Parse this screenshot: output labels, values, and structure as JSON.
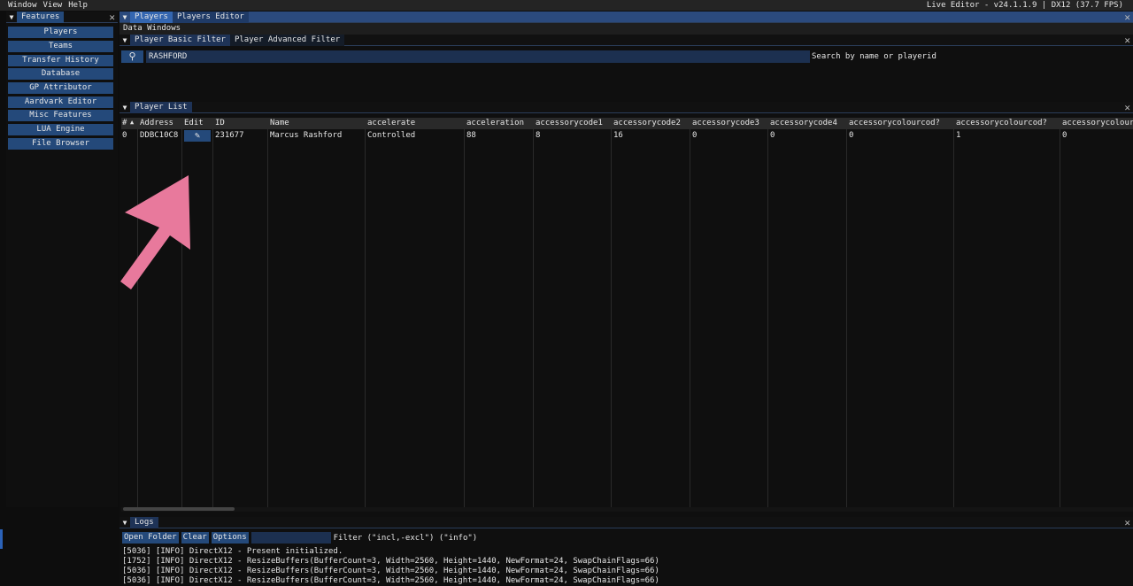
{
  "menubar": {
    "items": [
      "Window",
      "View",
      "Help"
    ],
    "version": "Live Editor - v24.1.1.9 | DX12 (37.7 FPS)"
  },
  "features": {
    "title": "Features",
    "items": [
      "Players",
      "Teams",
      "Transfer History",
      "Database",
      "GP Attributor",
      "Aardvark Editor",
      "Misc Features",
      "LUA Engine",
      "File Browser"
    ]
  },
  "main": {
    "tabs": [
      "Players",
      "Players Editor"
    ],
    "menu": [
      "Data",
      "Windows"
    ]
  },
  "filter": {
    "tabs": [
      "Player Basic Filter",
      "Player Advanced Filter"
    ],
    "search_value": "RASHFORD",
    "search_hint": "Search by name or playerid"
  },
  "player_list": {
    "title": "Player List",
    "columns": [
      "#",
      "Address",
      "Edit",
      "ID",
      "Name",
      "accelerate",
      "acceleration",
      "accessorycode1",
      "accessorycode2",
      "accessorycode3",
      "accessorycode4",
      "accessorycolourcod?",
      "accessorycolourcod?",
      "accessorycolour"
    ],
    "rows": [
      [
        "0",
        "DDBC10C8",
        "",
        "231677",
        "Marcus Rashford",
        "Controlled",
        "88",
        "8",
        "16",
        "0",
        "0",
        "0",
        "1",
        "0"
      ]
    ]
  },
  "logs": {
    "title": "Logs",
    "buttons": [
      "Open Folder",
      "Clear",
      "Options"
    ],
    "filter_label": "Filter (\"incl,-excl\") (\"info\")",
    "lines": [
      "[5036] [INFO] DirectX12 - Present initialized.",
      "[1752] [INFO] DirectX12 - ResizeBuffers(BufferCount=3, Width=2560, Height=1440, NewFormat=24, SwapChainFlags=66)",
      "[5036] [INFO] DirectX12 - ResizeBuffers(BufferCount=3, Width=2560, Height=1440, NewFormat=24, SwapChainFlags=66)",
      "[5036] [INFO] DirectX12 - ResizeBuffers(BufferCount=3, Width=2560, Height=1440, NewFormat=24, SwapChainFlags=66)"
    ]
  },
  "colors": {
    "accent": "#2b4a7d",
    "button": "#24497a",
    "arrow": "#e8799c"
  }
}
